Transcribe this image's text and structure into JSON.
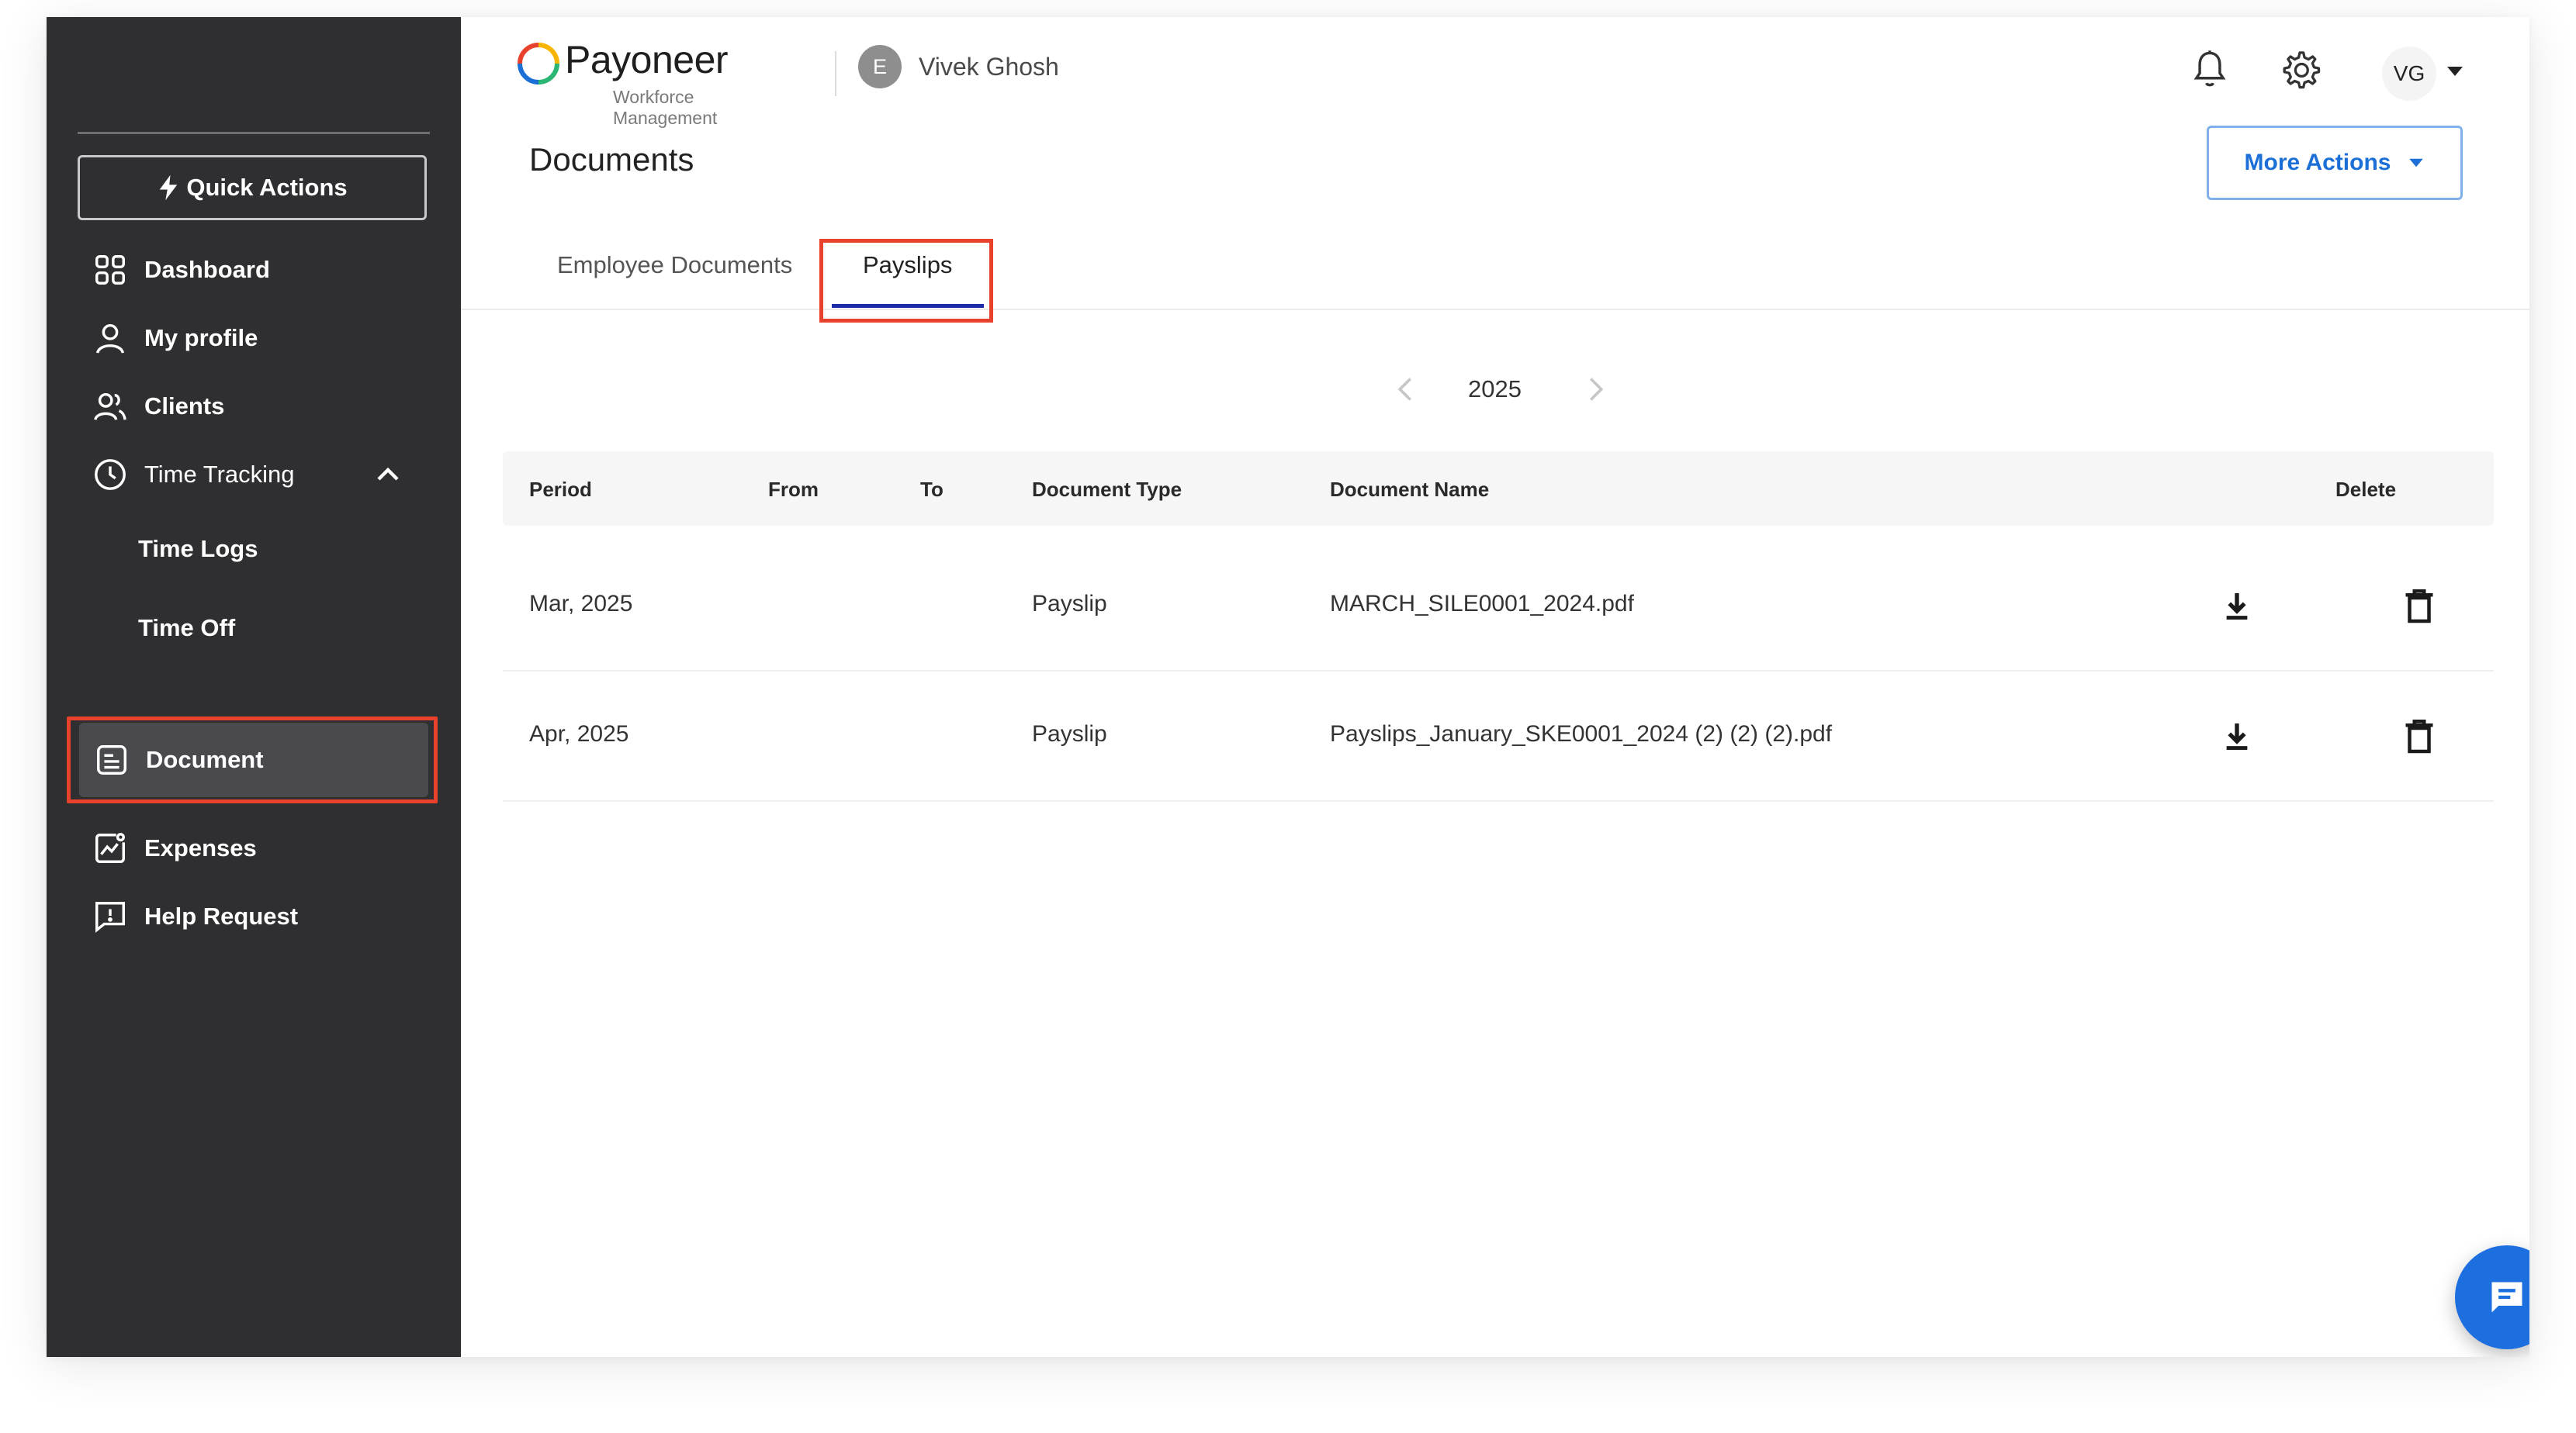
{
  "app": {
    "brand": "Payoneer",
    "brand_sub": "Workforce Management",
    "brand_colors": [
      "#e8412c",
      "#f7b500",
      "#2bb673",
      "#1b6fd6"
    ]
  },
  "header": {
    "entity_initial": "E",
    "user_name": "Vivek Ghosh",
    "avatar_initials": "VG",
    "icons": [
      "bell-icon",
      "gear-icon",
      "caret-down-icon"
    ]
  },
  "sidebar": {
    "quick_actions_label": "Quick Actions",
    "items": [
      {
        "label": "Dashboard",
        "icon": "grid-icon"
      },
      {
        "label": "My profile",
        "icon": "person-icon"
      },
      {
        "label": "Clients",
        "icon": "people-icon"
      },
      {
        "label": "Time Tracking",
        "icon": "clock-icon",
        "expanded": true
      },
      {
        "label": "Time Logs",
        "icon": ""
      },
      {
        "label": "Time Off",
        "icon": ""
      },
      {
        "label": "Document",
        "icon": "document-icon",
        "active": true
      },
      {
        "label": "Expenses",
        "icon": "chart-icon"
      },
      {
        "label": "Help Request",
        "icon": "help-chat-icon"
      }
    ]
  },
  "main": {
    "page_title": "Documents",
    "more_actions_label": "More Actions",
    "tabs": [
      {
        "label": "Employee Documents",
        "active": false
      },
      {
        "label": "Payslips",
        "active": true
      }
    ],
    "year": "2025",
    "table": {
      "columns": [
        "Period",
        "From",
        "To",
        "Document Type",
        "Document Name",
        "Delete"
      ],
      "rows": [
        {
          "period": "Mar, 2025",
          "from": "",
          "to": "",
          "type": "Payslip",
          "name": "MARCH_SILE0001_2024.pdf"
        },
        {
          "period": "Apr, 2025",
          "from": "",
          "to": "",
          "type": "Payslip",
          "name": "Payslips_January_SKE0001_2024 (2) (2) (2).pdf"
        }
      ]
    }
  },
  "colors": {
    "sidebar_bg": "#2f2e31",
    "accent_blue": "#1b6fd6",
    "highlight_red": "#e8412c"
  }
}
